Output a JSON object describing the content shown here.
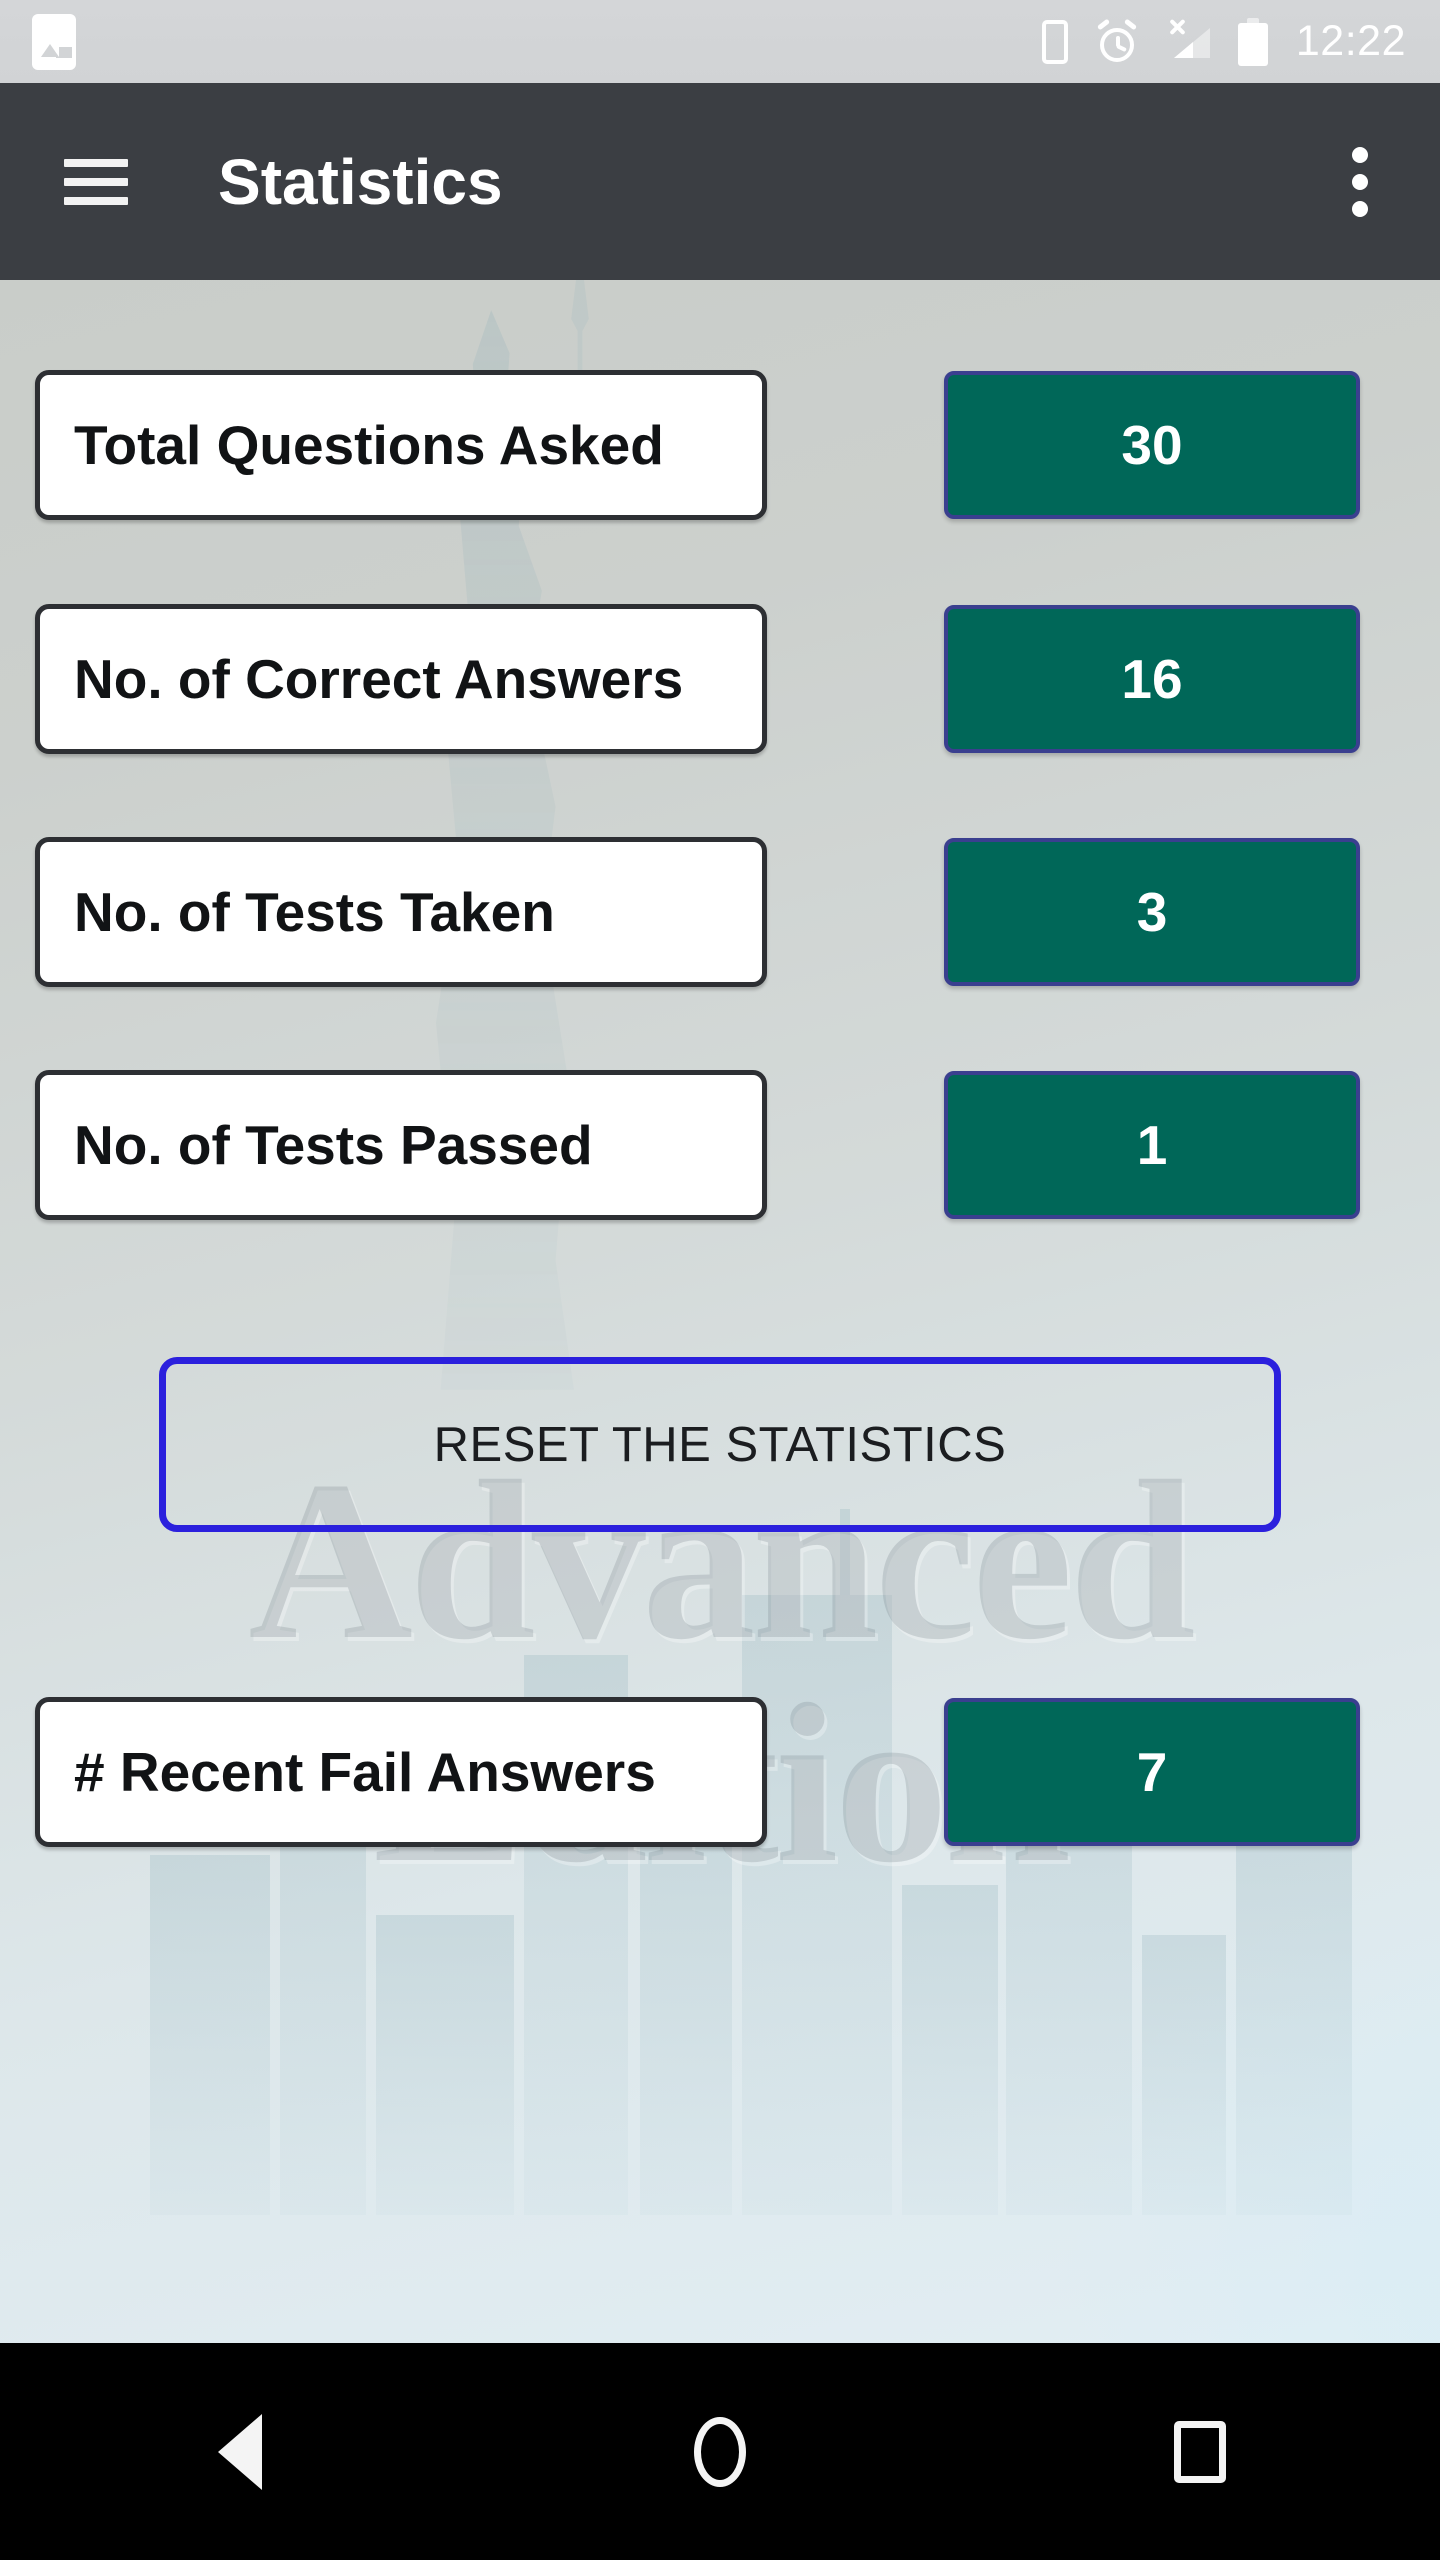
{
  "status_bar": {
    "notification_icon": "image-thumbnail-icon",
    "icons": [
      "vibrate-icon",
      "alarm-icon",
      "signal-no-sim-icon",
      "battery-icon"
    ],
    "time": "12:22"
  },
  "app_bar": {
    "menu_icon": "hamburger-menu-icon",
    "title": "Statistics",
    "overflow_icon": "overflow-menu-icon"
  },
  "background": {
    "watermark_line1": "Advanced",
    "watermark_line2": "Edition"
  },
  "stats": [
    {
      "label": "Total Questions Asked",
      "value": "30"
    },
    {
      "label": "No. of Correct Answers",
      "value": "16"
    },
    {
      "label": "No. of Tests Taken",
      "value": "3"
    },
    {
      "label": "No. of Tests Passed",
      "value": "1"
    }
  ],
  "reset_button": {
    "label": "RESET THE STATISTICS"
  },
  "recent": {
    "label": "# Recent Fail Answers",
    "value": "7"
  },
  "nav_bar": {
    "back": "back-triangle-icon",
    "home": "home-circle-icon",
    "recents": "recents-square-icon"
  },
  "colors": {
    "app_bar": "#3b3e43",
    "value_box": "#006758",
    "value_box_border": "#3a3f8f",
    "reset_border": "#2b20dd",
    "label_border": "#2d2f33",
    "status_bar": "#d3d5d7",
    "nav_bar": "#000000"
  }
}
